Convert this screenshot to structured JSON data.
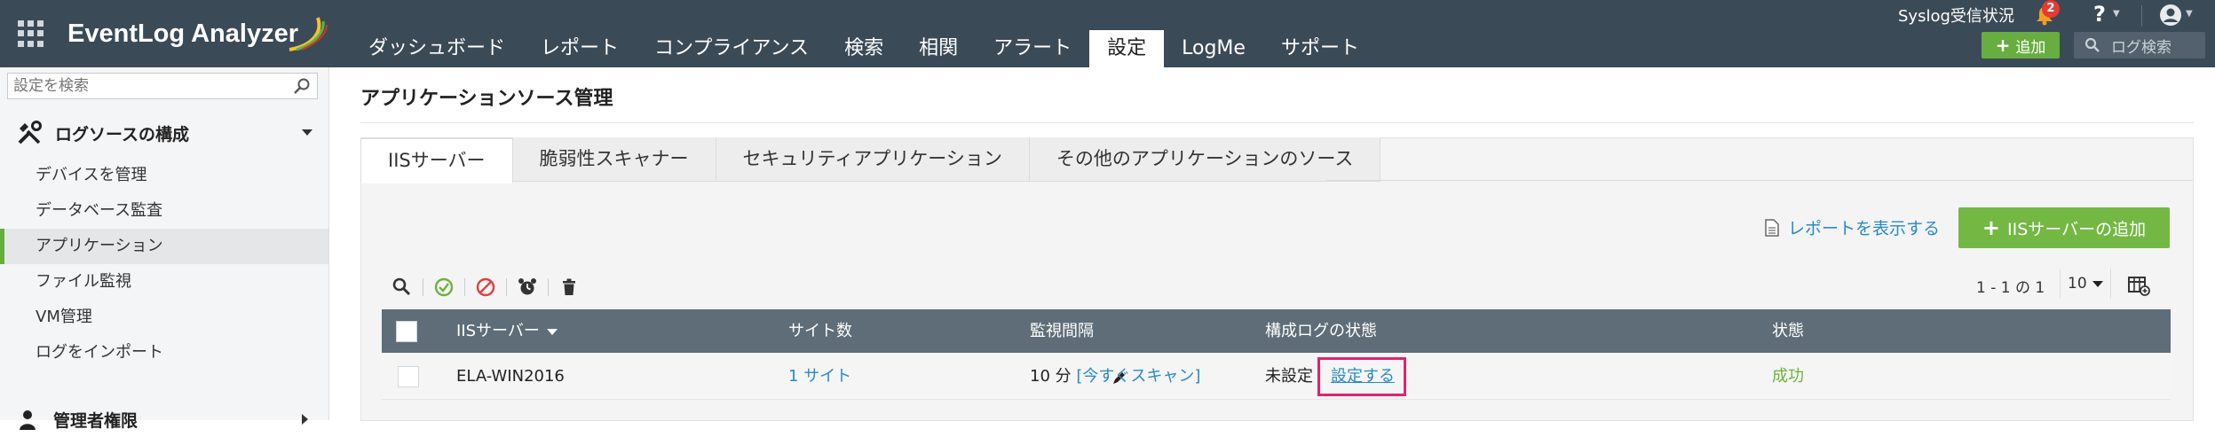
{
  "app": {
    "name": "EventLog Analyzer",
    "nav_tabs": [
      {
        "label": "ダッシュボード"
      },
      {
        "label": "レポート"
      },
      {
        "label": "コンプライアンス"
      },
      {
        "label": "検索"
      },
      {
        "label": "相関"
      },
      {
        "label": "アラート"
      },
      {
        "label": "設定",
        "active": true
      },
      {
        "label": "LogMe"
      },
      {
        "label": "サポート"
      }
    ],
    "syslog_status": "Syslog受信状況",
    "notification_count": "2",
    "help_label": "?",
    "add_button": "追加",
    "log_search": "ログ検索"
  },
  "sidebar": {
    "search_placeholder": "設定を検索",
    "section_title": "ログソースの構成",
    "items": [
      {
        "label": "デバイスを管理"
      },
      {
        "label": "データベース監査"
      },
      {
        "label": "アプリケーション",
        "active": true
      },
      {
        "label": "ファイル監視"
      },
      {
        "label": "VM管理"
      },
      {
        "label": "ログをインポート"
      }
    ],
    "next_section_title": "管理者権限"
  },
  "main": {
    "page_title": "アプリケーションソース管理",
    "tabs": [
      {
        "label": "IISサーバー",
        "active": true
      },
      {
        "label": "脆弱性スキャナー"
      },
      {
        "label": "セキュリティアプリケーション"
      },
      {
        "label": "その他のアプリケーションのソース"
      }
    ],
    "show_report": "レポートを表示する",
    "add_iis_server": "IISサーバーの追加",
    "pagination": "1 - 1 の 1",
    "per_page": "10",
    "table": {
      "columns": [
        "IISサーバー",
        "サイト数",
        "監視間隔",
        "構成ログの状態",
        "状態"
      ],
      "rows": [
        {
          "server": "ELA-WIN2016",
          "sites": "1 サイト",
          "interval": "10 分",
          "scan_now": "[今すぐスキャン]",
          "config_status": "未設定",
          "configure_link": "設定する",
          "status": "成功"
        }
      ]
    }
  },
  "colors": {
    "topbar": "#3b4a57",
    "accent_green": "#73b843",
    "link_blue": "#2a8ac8",
    "table_header": "#5e6d77",
    "highlight": "#e0226e",
    "success": "#6cb33e"
  }
}
